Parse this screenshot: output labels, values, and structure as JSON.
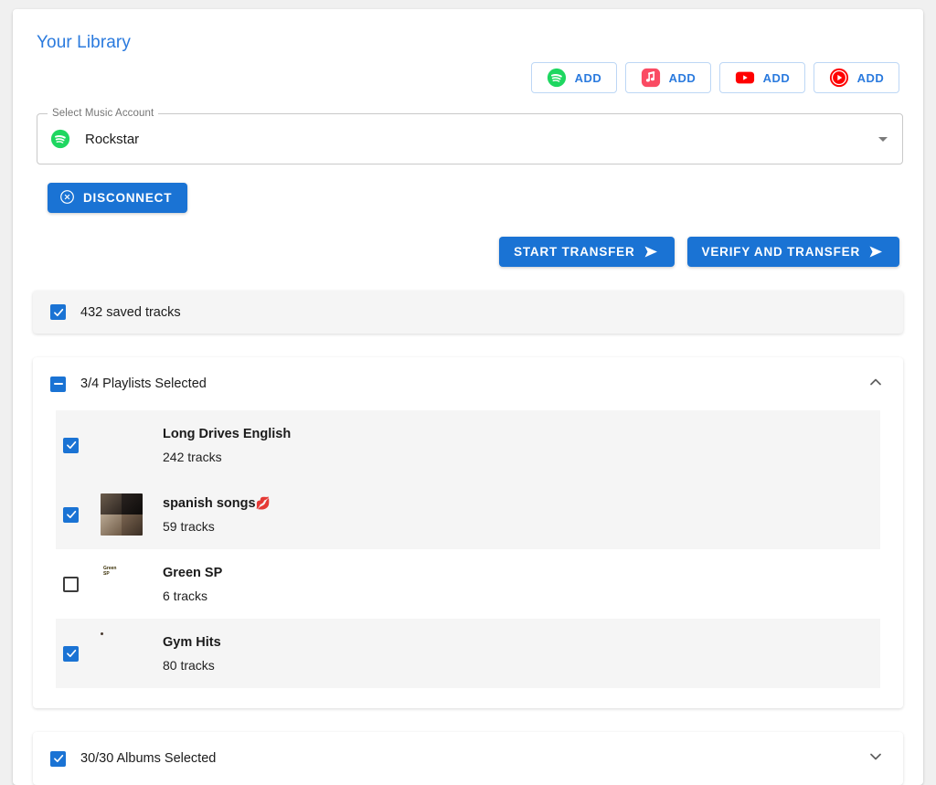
{
  "header": {
    "title": "Your Library"
  },
  "add_buttons": [
    {
      "service": "spotify",
      "label": "ADD",
      "color": "#1ed760"
    },
    {
      "service": "apple-music",
      "label": "ADD",
      "color": "#fa4b63"
    },
    {
      "service": "youtube",
      "label": "ADD",
      "color": "#ff0000"
    },
    {
      "service": "youtube-music",
      "label": "ADD",
      "color": "#ff0000"
    }
  ],
  "account_select": {
    "legend": "Select Music Account",
    "value": "Rockstar",
    "service": "spotify"
  },
  "disconnect": {
    "label": "DISCONNECT"
  },
  "transfer": {
    "start_label": "START TRANSFER",
    "verify_label": "VERIFY AND TRANSFER"
  },
  "saved_tracks": {
    "label": "432 saved tracks",
    "checked": true
  },
  "playlists_section": {
    "label": "3/4 Playlists Selected",
    "state": "indeterminate",
    "expanded": true,
    "items": [
      {
        "name": "Long Drives English",
        "emoji": "",
        "tracks": "242 tracks",
        "checked": true,
        "art": "drives"
      },
      {
        "name": "spanish songs",
        "emoji": "💋",
        "tracks": "59 tracks",
        "checked": true,
        "art": "collage"
      },
      {
        "name": "Green SP",
        "emoji": "",
        "tracks": "6 tracks",
        "checked": false,
        "art": "green"
      },
      {
        "name": "Gym Hits",
        "emoji": "",
        "tracks": "80 tracks",
        "checked": true,
        "art": "gym"
      }
    ]
  },
  "albums_section": {
    "label": "30/30 Albums Selected",
    "state": "checked",
    "expanded": false
  },
  "colors": {
    "accent": "#1a73d4",
    "title": "#2a7ade",
    "row_selected_bg": "#f5f5f5",
    "page_bg": "#f0f0f0"
  }
}
